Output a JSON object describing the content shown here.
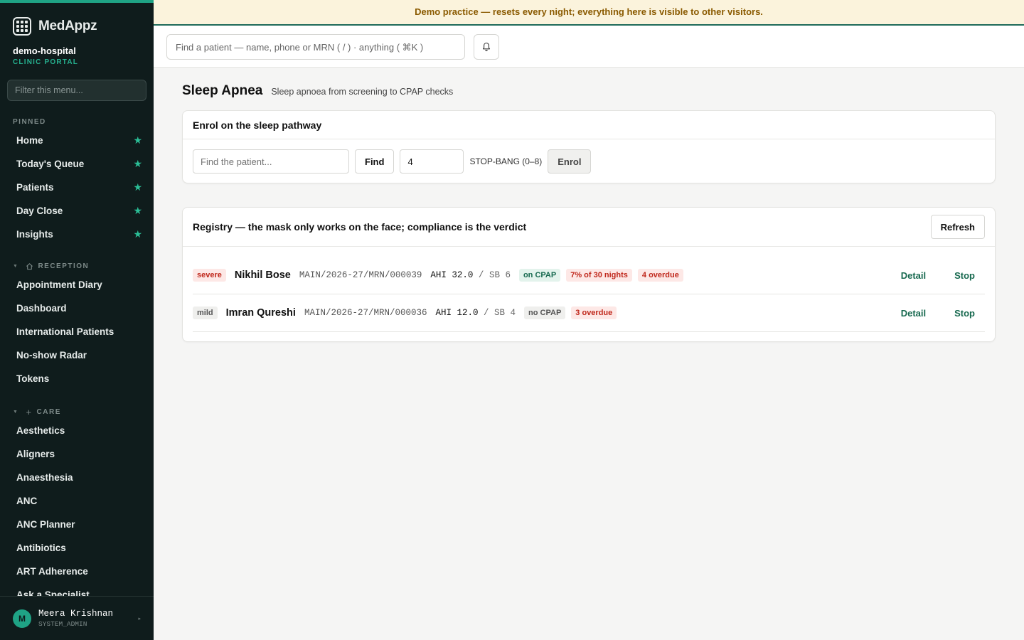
{
  "brand": {
    "name": "MedAppz"
  },
  "org": {
    "name": "demo-hospital",
    "subtitle": "CLINIC PORTAL"
  },
  "sidebar": {
    "filter_placeholder": "Filter this menu...",
    "pinned_label": "PINNED",
    "pinned": [
      {
        "label": "Home"
      },
      {
        "label": "Today's Queue"
      },
      {
        "label": "Patients"
      },
      {
        "label": "Day Close"
      },
      {
        "label": "Insights"
      }
    ],
    "reception_label": "RECEPTION",
    "reception": [
      {
        "label": "Appointment Diary"
      },
      {
        "label": "Dashboard"
      },
      {
        "label": "International Patients"
      },
      {
        "label": "No-show Radar"
      },
      {
        "label": "Tokens"
      }
    ],
    "care_label": "CARE",
    "care": [
      {
        "label": "Aesthetics"
      },
      {
        "label": "Aligners"
      },
      {
        "label": "Anaesthesia"
      },
      {
        "label": "ANC"
      },
      {
        "label": "ANC Planner"
      },
      {
        "label": "Antibiotics"
      },
      {
        "label": "ART Adherence"
      },
      {
        "label": "Ask a Specialist"
      }
    ]
  },
  "user": {
    "initial": "M",
    "name": "Meera Krishnan",
    "role": "SYSTEM_ADMIN"
  },
  "banner": {
    "text": "Demo practice — resets every night; everything here is visible to other visitors."
  },
  "topbar": {
    "search_placeholder": "Find a patient — name, phone or MRN ( / ) · anything ( ⌘K )"
  },
  "page": {
    "title": "Sleep Apnea",
    "subtitle": "Sleep apnoea from screening to CPAP checks"
  },
  "enrol": {
    "title": "Enrol on the sleep pathway",
    "patient_placeholder": "Find the patient...",
    "find_label": "Find",
    "score_value": "4",
    "score_hint": "STOP-BANG (0–8)",
    "enrol_label": "Enrol"
  },
  "registry": {
    "title": "Registry — the mask only works on the face; compliance is the verdict",
    "refresh_label": "Refresh",
    "rows": [
      {
        "severity": "severe",
        "name": "Nikhil Bose",
        "mrn": "MAIN/2026-27/MRN/000039",
        "ahi": "AHI 32.0",
        "sep": "/",
        "sb": "SB 6",
        "cpap": "on CPAP",
        "compliance": "7% of 30 nights",
        "overdue": "4 overdue",
        "detail_label": "Detail",
        "stop_label": "Stop"
      },
      {
        "severity": "mild",
        "name": "Imran Qureshi",
        "mrn": "MAIN/2026-27/MRN/000036",
        "ahi": "AHI 12.0",
        "sep": "/",
        "sb": "SB 4",
        "cpap": "no CPAP",
        "overdue": "3 overdue",
        "detail_label": "Detail",
        "stop_label": "Stop"
      }
    ]
  },
  "colors": {
    "accent": "#1fa385",
    "sidebar_bg": "#0f1c1c",
    "banner_bg": "#fbf3dc",
    "danger": "#c0281c"
  }
}
